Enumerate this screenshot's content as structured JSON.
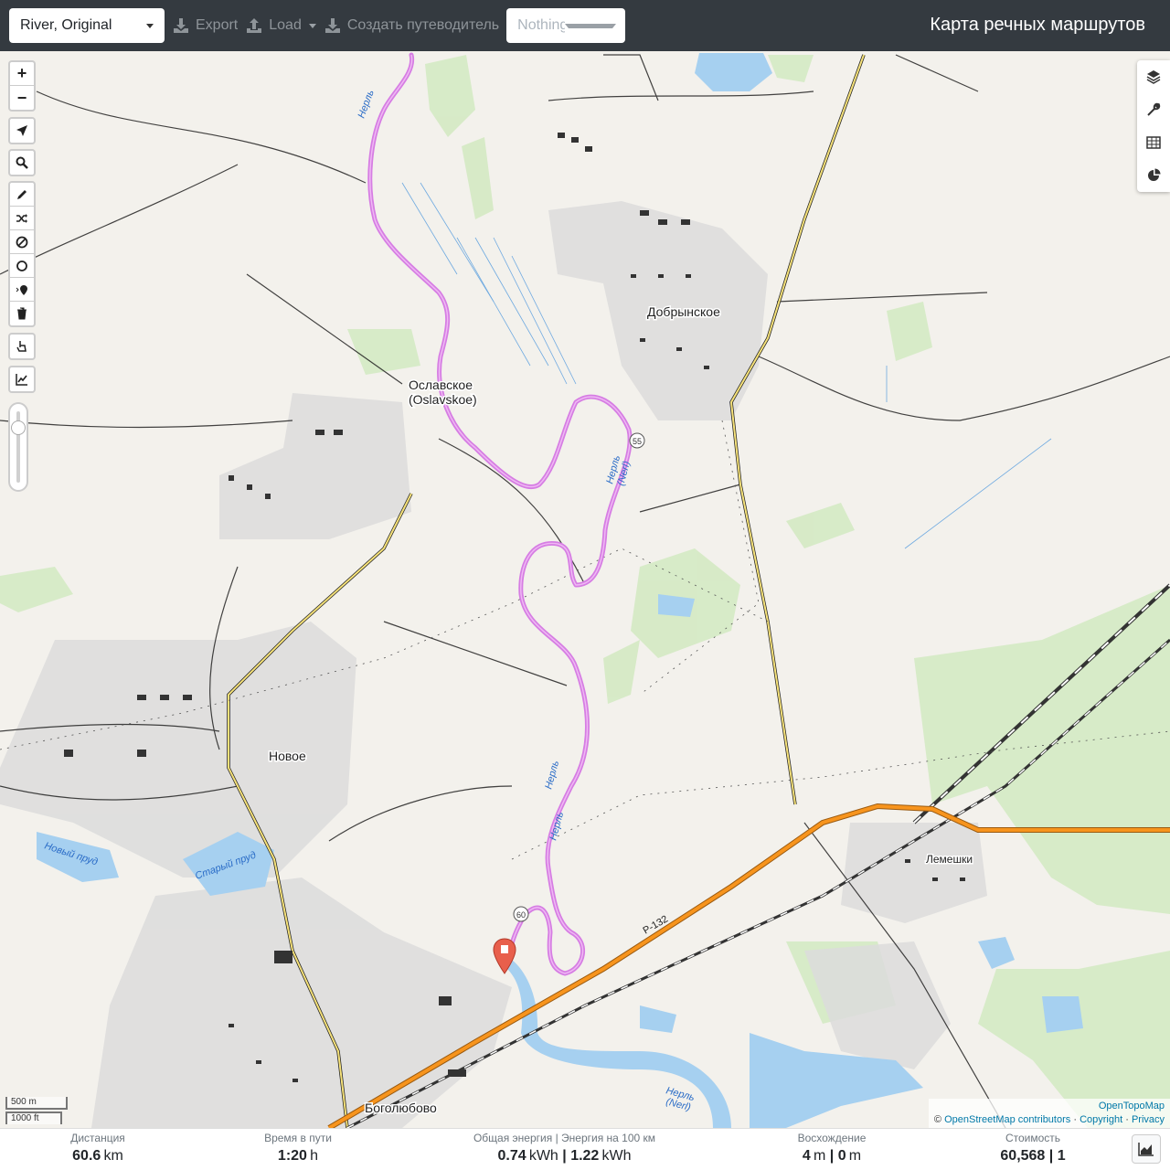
{
  "topbar": {
    "profile": "River, Original",
    "export_label": "Export",
    "load_label": "Load",
    "guide_label": "Создать путеводитель",
    "nothing_selected": "Nothing selected",
    "title": "Карта речных маршрутов"
  },
  "map": {
    "places": {
      "dobrynskoe": "Добрынское",
      "oslavskoe": "Ославское",
      "oslavskoe_latin": "(Oslavskoe)",
      "novoe": "Новое",
      "lemeshki": "Лемешки",
      "bogolyubovo": "Боголюбово",
      "novy_prud": "Новый пруд",
      "stary_prud": "Старый пруд",
      "river_nerl": "Нерль",
      "river_nerl_latin": "(Nerl)",
      "road_r132": "Р-132",
      "road_55": "55",
      "road_60": "60"
    },
    "scale": {
      "metric": "500 m",
      "imperial": "1000 ft"
    },
    "attribution": {
      "provider": "OpenTopoMap",
      "osm": "OpenStreetMap contributors",
      "copyright": "Copyright",
      "privacy": "Privacy",
      "sep": "·",
      "copy_sign": "©"
    },
    "colors": {
      "route": "#d67de3",
      "river": "#a6d0f0",
      "highway": "#f7941d"
    }
  },
  "stats": {
    "distance": {
      "label": "Дистанция",
      "value": "60.6",
      "unit": "km"
    },
    "time": {
      "label": "Время в пути",
      "value": "1:20",
      "unit": "h"
    },
    "energy": {
      "label": "Общая энергия | Энергия на 100 км",
      "value1": "0.74",
      "unit1": "kWh",
      "value2": "1.22",
      "unit2": "kWh"
    },
    "ascent": {
      "label": "Восхождение",
      "value1": "4",
      "unit1": "m",
      "value2": "0",
      "unit2": "m"
    },
    "cost": {
      "label": "Стоимость",
      "value1": "60,568",
      "value2": "1"
    }
  }
}
